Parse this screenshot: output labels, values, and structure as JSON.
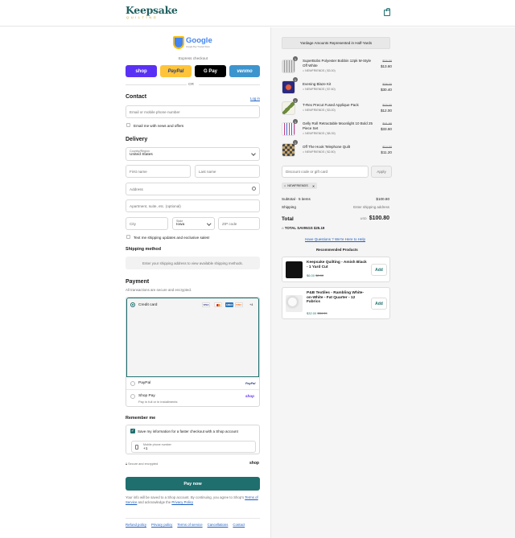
{
  "header": {
    "brand_line1": "Keepsake",
    "brand_line2": "QUILTING"
  },
  "checkout": {
    "badge_title": "Google",
    "badge_sub": "Google Buy Trusted Store",
    "express_label": "Express checkout",
    "express": {
      "shop": "shop",
      "paypal": "PayPal",
      "gpay": "G Pay",
      "venmo": "venmo"
    },
    "or": "OR"
  },
  "contact": {
    "title": "Contact",
    "login": "Log in",
    "email_placeholder": "Email or mobile phone number",
    "news": "Email me with news and offers"
  },
  "delivery": {
    "title": "Delivery",
    "country_label": "Country/Region",
    "country": "United States",
    "first": "First name",
    "last": "Last name",
    "address": "Address",
    "apt": "Apartment, suite, etc. (optional)",
    "city": "City",
    "state_label": "State",
    "state": "Iowa",
    "zip": "ZIP code",
    "sms": "Text me shipping updates and exclusive sales!"
  },
  "shipping": {
    "title": "Shipping method",
    "notice": "Enter your shipping address to view available shipping methods."
  },
  "payment": {
    "title": "Payment",
    "sub": "All transactions are secure and encrypted.",
    "credit": "Credit card",
    "more": "+4",
    "paypal": "PayPal",
    "paypal_logo": "PayPal",
    "shoppay": "Shop Pay",
    "shoppay_sub": "Pay in full or in installments",
    "shop_logo": "shop"
  },
  "remember": {
    "title": "Remember me",
    "save": "Save my information for a faster checkout with a Shop account",
    "phone_label": "Mobile phone number",
    "phone": "+1",
    "secure": "Secure and encrypted",
    "shop": "shop"
  },
  "pay_now": "Pay now",
  "legal": {
    "line1": "Your info will be saved to a Shop account. By continuing, you agree to Shop's",
    "terms": "Terms of Service",
    "and": "and acknowledge the",
    "privacy": "Privacy Policy"
  },
  "footer": {
    "refund": "Refund policy",
    "privacy": "Privacy policy",
    "terms": "Terms of service",
    "cancel": "Cancellations",
    "contact": "Contact"
  },
  "summary": {
    "banner": "Yardage Amounts Represented in Half-Yards",
    "items": [
      {
        "qty": "1",
        "name": "SuperBobs Polyester Bobbin 12pk M-Style Off White",
        "disc": "NEWFRIENDS ( $3.00)",
        "old": "$16.00",
        "price": "$13.60"
      },
      {
        "qty": "1",
        "name": "Evening Blaze Kit",
        "disc": "NEWFRIENDS ( $7.60)",
        "old": "$38.00",
        "price": "$30.40"
      },
      {
        "qty": "1",
        "name": "T-Rex Precut Fused Applique Pack",
        "disc": "NEWFRIENDS ( $3.00)",
        "old": "$15.00",
        "price": "$12.00"
      },
      {
        "qty": "1",
        "name": "Gelly Roll Retractable Moonlight 10 Bold 25 Piece Set",
        "disc": "NEWFRIENDS ( $8.39)",
        "old": "$41.99",
        "price": "$33.60"
      },
      {
        "qty": "1",
        "name": "Off The Hook Telephone Quilt",
        "disc": "NEWFRIENDS ( $2.80)",
        "old": "$14.00",
        "price": "$11.20"
      }
    ],
    "discount_placeholder": "Discount code or gift card",
    "apply": "Apply",
    "code": "NEWFRIENDS",
    "subtotal_label": "Subtotal · 5 items",
    "subtotal": "$100.80",
    "shipping_label": "Shipping",
    "shipping": "Enter shipping address",
    "total_label": "Total",
    "currency": "USD",
    "total": "$100.80",
    "savings": "TOTAL SAVINGS $25.19",
    "help": "Have Questions ? We're Here to Help",
    "rec_title": "Recommended Products",
    "recs": [
      {
        "name": "Keepsake Quilting - Amish Black - 1 Yard Cut",
        "price": "$6.00",
        "old": "$8.00",
        "add": "Add"
      },
      {
        "name": "P&B Textiles - Rambling White-on-White - Fat Quarter - 12 Fabrics",
        "price": "$32.00",
        "old": "$34.99",
        "add": "Add"
      }
    ]
  },
  "colors": {
    "accent": "#1f6f6f",
    "link": "#1f5fbf",
    "shop": "#5a31f4",
    "paypal": "#ffc439",
    "venmo": "#3d95ce"
  }
}
